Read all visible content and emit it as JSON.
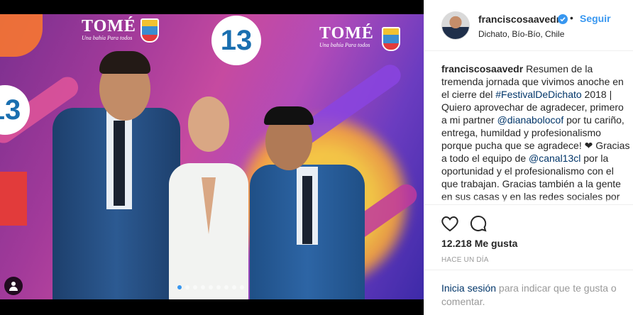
{
  "post": {
    "username": "franciscosaavedr",
    "separator": "•",
    "follow_label": "Seguir",
    "location": "Dichato, Bío-Bío, Chile",
    "caption_parts": [
      {
        "text": "franciscosaavedr",
        "kind": "user"
      },
      {
        "text": " Resumen de la tremenda jornada que vivimos anoche en el cierre del ",
        "kind": "text"
      },
      {
        "text": "#FestivalDeDichato",
        "kind": "tag"
      },
      {
        "text": " 2018 | Quiero aprovechar de agradecer, primero a mi partner ",
        "kind": "text"
      },
      {
        "text": "@dianabolocof",
        "kind": "tag"
      },
      {
        "text": " por tu cariño, entrega, humildad y profesionalismo porque pucha que se agradece! ❤ Gracias a todo el equipo de ",
        "kind": "text"
      },
      {
        "text": "@canal13cl",
        "kind": "tag"
      },
      {
        "text": " por la oportunidad y el profesionalismo con el que trabajan. Gracias también a la gente en sus casas y en las redes sociales por",
        "kind": "text"
      }
    ],
    "likes": "12.218 Me gusta",
    "time": "HACE UN DÍA",
    "login_link": "Inicia sesión",
    "login_rest": " para indicar que te gusta o comentar."
  },
  "media": {
    "backdrop_text_tome": "TOMÉ",
    "backdrop_text_tome_sub": "Una bahía Para todos",
    "backdrop_logo_13": "13",
    "carousel": {
      "count": 9,
      "active_index": 0
    }
  },
  "icons": {
    "heart": "heart-icon",
    "comment": "comment-icon",
    "verified": "verified-badge-icon",
    "user_tag": "user-tag-icon"
  },
  "colors": {
    "accent": "#3897f0",
    "link": "#003569",
    "muted": "#999999"
  }
}
